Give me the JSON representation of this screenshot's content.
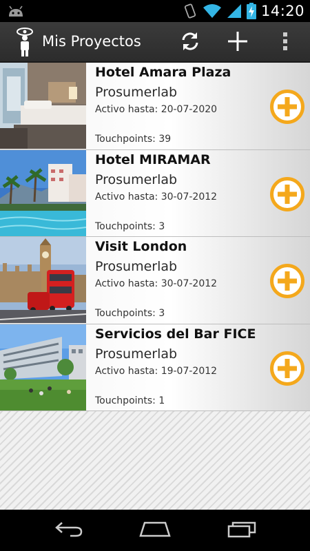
{
  "status_bar": {
    "time": "14:20",
    "icons": [
      "android-notification-icon",
      "vibrate-icon",
      "wifi-icon",
      "signal-icon",
      "battery-charging-icon"
    ]
  },
  "action_bar": {
    "title": "Mis Proyectos",
    "actions": [
      "refresh-icon",
      "add-icon",
      "overflow-menu-icon"
    ]
  },
  "projects": [
    {
      "title": "Hotel Amara Plaza",
      "company": "Prosumerlab",
      "active_until": "Activo hasta: 20-07-2020",
      "touchpoints": "Touchpoints: 39",
      "thumbnail": "hotel-room-photo"
    },
    {
      "title": "Hotel MIRAMAR",
      "company": "Prosumerlab",
      "active_until": "Activo hasta: 30-07-2012",
      "touchpoints": "Touchpoints: 3",
      "thumbnail": "hotel-pool-photo"
    },
    {
      "title": "Visit London",
      "company": "Prosumerlab",
      "active_until": "Activo hasta: 30-07-2012",
      "touchpoints": "Touchpoints: 3",
      "thumbnail": "london-bus-photo"
    },
    {
      "title": "Servicios del Bar FICE",
      "company": "Prosumerlab",
      "active_until": "Activo hasta: 19-07-2012",
      "touchpoints": "Touchpoints: 1",
      "thumbnail": "campus-building-photo"
    }
  ],
  "nav_bar": {
    "buttons": [
      "back-icon",
      "home-icon",
      "recent-apps-icon"
    ]
  },
  "colors": {
    "accent_orange": "#f4a81c",
    "action_bar": "#333333",
    "status_icons": "#33b5e5"
  }
}
